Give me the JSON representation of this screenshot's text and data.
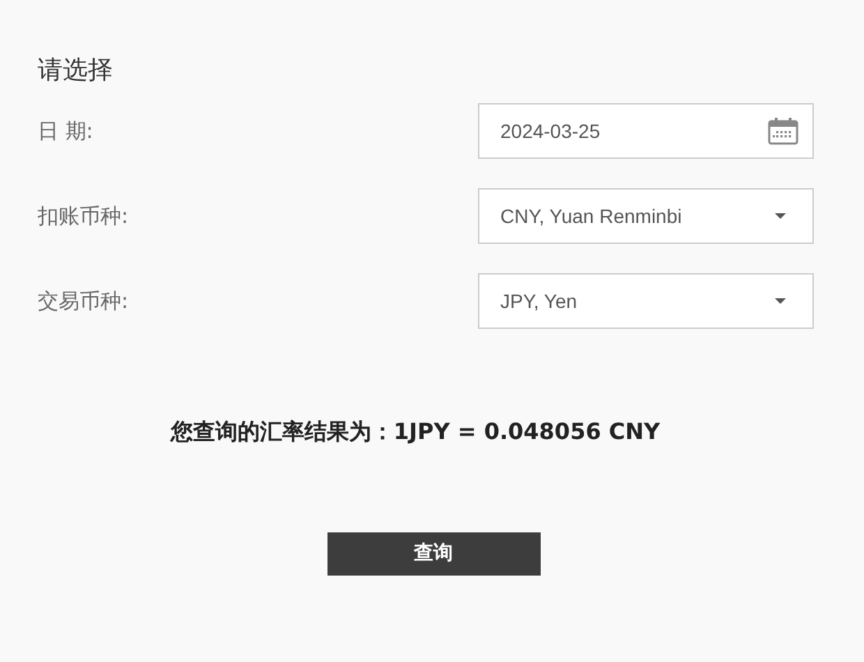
{
  "heading": "请选择",
  "fields": [
    {
      "kind": "date",
      "label": "日 期:",
      "value": "2024-03-25"
    },
    {
      "kind": "select",
      "label": "扣账币种:",
      "value": "CNY, Yuan Renminbi"
    },
    {
      "kind": "select",
      "label": "交易币种:",
      "value": "JPY, Yen"
    }
  ],
  "result": "您查询的汇率结果为：1JPY = 0.048056 CNY",
  "button": "查询"
}
